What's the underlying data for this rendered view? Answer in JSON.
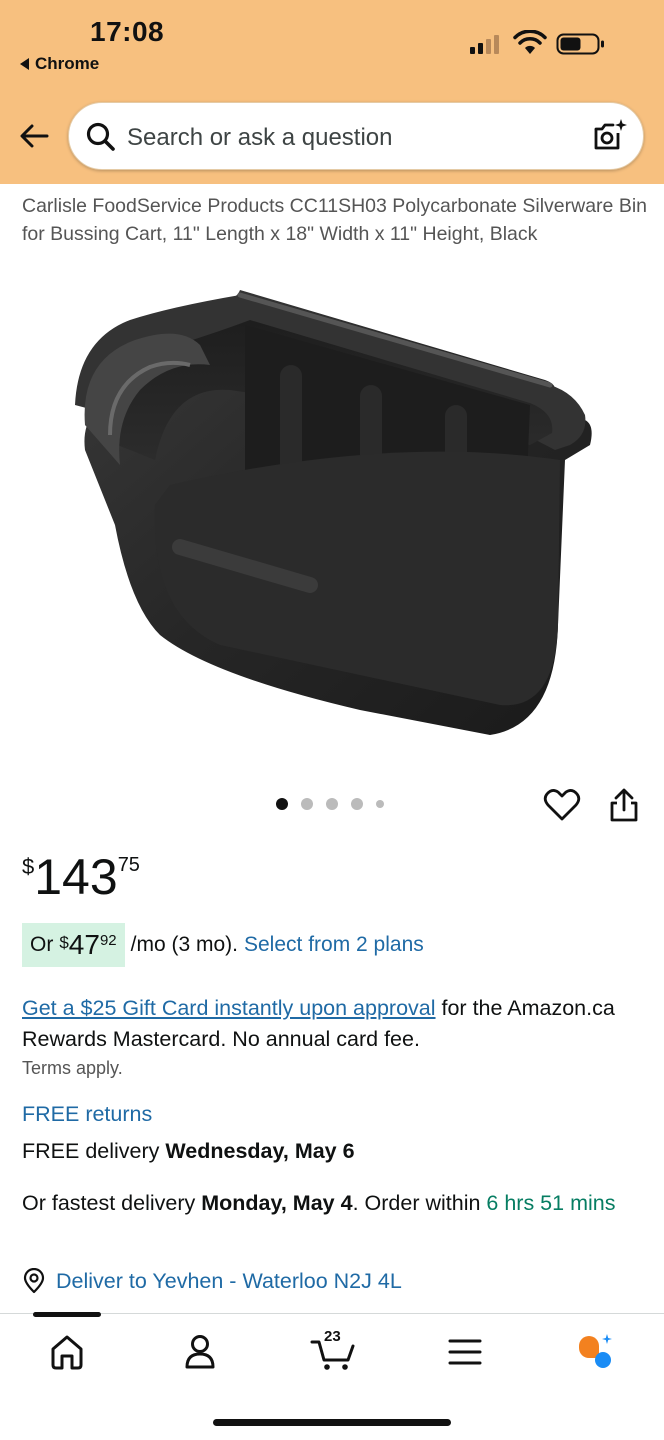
{
  "status_bar": {
    "time": "17:08",
    "back_app": "Chrome"
  },
  "search": {
    "placeholder": "Search or ask a question"
  },
  "product": {
    "title": "Carlisle FoodService Products CC11SH03 Polycarbonate Silverware Bin for Bussing Cart, 11\" Length x 18\" Width x 11\" Height, Black",
    "image_count": 5,
    "active_image_index": 0
  },
  "price": {
    "symbol": "$",
    "whole": "143",
    "fraction": "75"
  },
  "monthly": {
    "prefix": "Or",
    "symbol": "$",
    "whole": "47",
    "fraction": "92",
    "suffix": "/mo (3 mo).",
    "link": "Select from 2 plans"
  },
  "card_offer": {
    "link": "Get a $25 Gift Card instantly upon approval",
    "text": " for the Amazon.ca Rewards Mastercard. No annual card fee.",
    "terms": "Terms apply."
  },
  "delivery": {
    "free_returns": "FREE returns",
    "free_delivery_prefix": "FREE delivery ",
    "free_delivery_date": "Wednesday, May 6",
    "fastest_prefix": "Or fastest delivery ",
    "fastest_date": "Monday, May 4",
    "order_within_prefix": ". Order within ",
    "order_within_time": "6 hrs 51 mins",
    "deliver_to": "Deliver to Yevhen - Waterloo N2J 4L"
  },
  "bottom_nav": {
    "cart_count": "23",
    "items": [
      "home-icon",
      "account-icon",
      "cart-icon",
      "menu-icon",
      "rufus-icon"
    ]
  },
  "colors": {
    "header_bg": "#f7c07f",
    "link": "#1f6aa5",
    "green": "#067d62",
    "monthly_bg": "#d5f2e2",
    "rufus_orange": "#f3811f",
    "rufus_blue": "#1a8cf5"
  }
}
